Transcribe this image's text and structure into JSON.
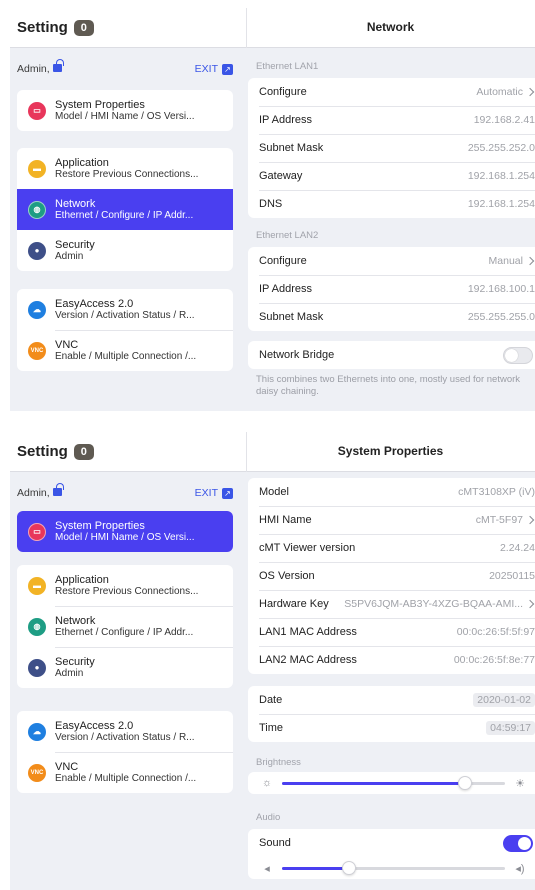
{
  "screen1": {
    "left_title": "Setting",
    "badge": "0",
    "right_title": "Network",
    "user": "Admin,",
    "exit_label": "EXIT",
    "menu_groups": [
      [
        {
          "title": "System Properties",
          "subtitle": "Model / HMI Name / OS Versi...",
          "icon": "system-properties-icon",
          "selected": false
        }
      ],
      [
        {
          "title": "Application",
          "subtitle": "Restore Previous Connections...",
          "icon": "application-icon",
          "selected": false
        },
        {
          "title": "Network",
          "subtitle": "Ethernet / Configure / IP Addr...",
          "icon": "network-globe-icon",
          "selected": true
        },
        {
          "title": "Security",
          "subtitle": "Admin",
          "icon": "security-user-icon",
          "selected": false
        }
      ],
      [
        {
          "title": "EasyAccess 2.0",
          "subtitle": "Version / Activation Status / R...",
          "icon": "easyaccess-icon",
          "selected": false
        },
        {
          "title": "VNC",
          "subtitle": "Enable / Multiple Connection /...",
          "icon": "vnc-icon",
          "selected": false
        }
      ]
    ],
    "lan1_label": "Ethernet LAN1",
    "lan1": [
      {
        "label": "Configure",
        "value": "Automatic",
        "chevron": true
      },
      {
        "label": "IP Address",
        "value": "192.168.2.41"
      },
      {
        "label": "Subnet Mask",
        "value": "255.255.252.0"
      },
      {
        "label": "Gateway",
        "value": "192.168.1.254"
      },
      {
        "label": "DNS",
        "value": "192.168.1.254"
      }
    ],
    "lan2_label": "Ethernet LAN2",
    "lan2": [
      {
        "label": "Configure",
        "value": "Manual",
        "chevron": true
      },
      {
        "label": "IP Address",
        "value": "192.168.100.1"
      },
      {
        "label": "Subnet Mask",
        "value": "255.255.255.0"
      }
    ],
    "bridge_label": "Network Bridge",
    "bridge_on": false,
    "bridge_note": "This combines two Ethernets into one, mostly used for network daisy chaining."
  },
  "screen2": {
    "left_title": "Setting",
    "badge": "0",
    "right_title": "System Properties",
    "user": "Admin,",
    "exit_label": "EXIT",
    "menu_groups": [
      [
        {
          "title": "System Properties",
          "subtitle": "Model / HMI Name / OS Versi...",
          "icon": "system-properties-icon",
          "selected": true
        }
      ],
      [
        {
          "title": "Application",
          "subtitle": "Restore Previous Connections...",
          "icon": "application-icon",
          "selected": false
        },
        {
          "title": "Network",
          "subtitle": "Ethernet / Configure / IP Addr...",
          "icon": "network-globe-icon",
          "selected": false
        },
        {
          "title": "Security",
          "subtitle": "Admin",
          "icon": "security-user-icon",
          "selected": false
        }
      ],
      [
        {
          "title": "EasyAccess 2.0",
          "subtitle": "Version / Activation Status / R...",
          "icon": "easyaccess-icon",
          "selected": false
        },
        {
          "title": "VNC",
          "subtitle": "Enable / Multiple Connection /...",
          "icon": "vnc-icon",
          "selected": false
        }
      ]
    ],
    "props": [
      {
        "label": "Model",
        "value": "cMT3108XP (iV)"
      },
      {
        "label": "HMI Name",
        "value": "cMT-5F97",
        "chevron": true
      },
      {
        "label": "cMT Viewer version",
        "value": "2.24.24"
      },
      {
        "label": "OS Version",
        "value": "20250115"
      },
      {
        "label": "Hardware Key",
        "value": "S5PV6JQM-AB3Y-4XZG-BQAA-AMI...",
        "chevron": true
      },
      {
        "label": "LAN1 MAC Address",
        "value": "00:0c:26:5f:5f:97"
      },
      {
        "label": "LAN2 MAC Address",
        "value": "00:0c:26:5f:8e:77"
      }
    ],
    "datetime": [
      {
        "label": "Date",
        "value": "2020-01-02"
      },
      {
        "label": "Time",
        "value": "04:59:17"
      }
    ],
    "brightness_label": "Brightness",
    "brightness_level": 0.82,
    "audio_label": "Audio",
    "sound_label": "Sound",
    "sound_on": true,
    "volume_level": 0.3
  },
  "colors": {
    "accent": "#4a3ff0",
    "system": "#e8365b",
    "application": "#f2b325",
    "network": "#1e9d84",
    "security": "#3e4f88",
    "easyaccess": "#1f7fe0",
    "vnc": "#f28c1a"
  }
}
